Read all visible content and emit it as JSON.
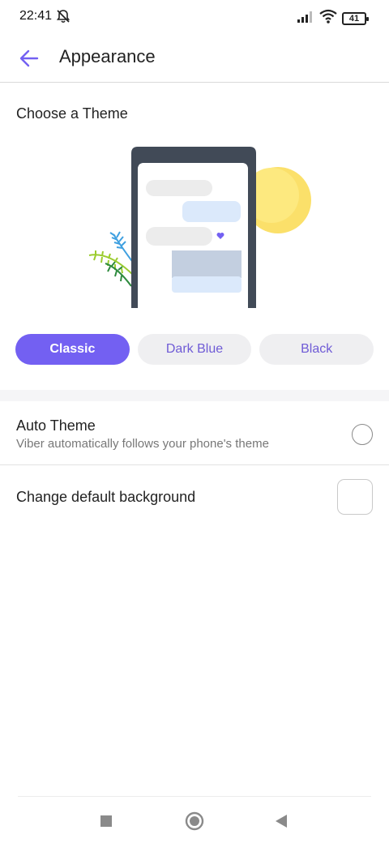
{
  "status": {
    "time": "22:41",
    "battery": "41"
  },
  "header": {
    "title": "Appearance"
  },
  "theme_section": {
    "title": "Choose a Theme",
    "options": [
      "Classic",
      "Dark Blue",
      "Black"
    ],
    "selected": "Classic"
  },
  "auto_theme": {
    "title": "Auto Theme",
    "subtitle": "Viber automatically follows your phone's theme",
    "checked": false
  },
  "background": {
    "title": "Change default background"
  },
  "colors": {
    "accent": "#7360f2",
    "chip_bg": "#efeff1",
    "phone_frame": "#414a57",
    "sun": "#fbe06a"
  },
  "icons": {
    "back": "arrow-left-icon",
    "mute": "bell-off-icon",
    "signal": "signal-icon",
    "wifi": "wifi-icon",
    "battery": "battery-icon",
    "nav_recents": "square-icon",
    "nav_home": "circle-icon",
    "nav_back": "triangle-icon"
  }
}
